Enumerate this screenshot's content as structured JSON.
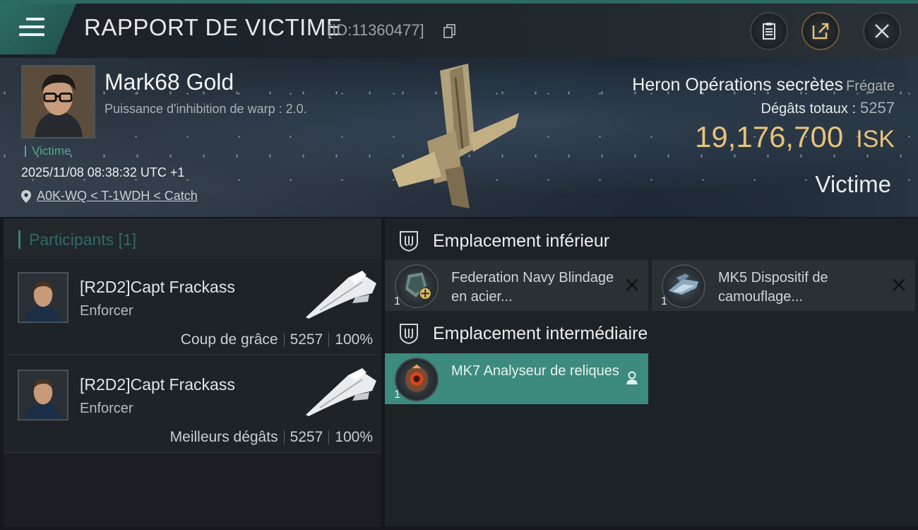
{
  "header": {
    "title": "RAPPORT DE VICTIME",
    "id_label": "[ID:11360477]",
    "buttons": [
      "clipboard-icon",
      "share-icon",
      "close-icon"
    ]
  },
  "victim": {
    "name": "Mark68 Gold",
    "subtitle": "Puissance d'inhibition de warp : 2.0.",
    "role_tag": "Victime",
    "datetime": "2025/11/08 08:38:32 UTC +1",
    "location": "A0K-WQ < T-1WDH < Catch",
    "ship_name": "Heron Opérations secrètes",
    "ship_class": "Frégate",
    "total_damage_label": "Dégâts totaux :",
    "total_damage_value": "5257",
    "isk_value": "19,176,700",
    "isk_unit": "ISK",
    "role_right": "Victime"
  },
  "participants": {
    "label": "Participants",
    "count": "[1]",
    "rows": [
      {
        "name": "[R2D2]Capt Frackass",
        "ship": "Enforcer",
        "stat_label": "Coup de grâce",
        "damage": "5257",
        "percent": "100%"
      },
      {
        "name": "[R2D2]Capt Frackass",
        "ship": "Enforcer",
        "stat_label": "Meilleurs dégâts",
        "damage": "5257",
        "percent": "100%"
      }
    ]
  },
  "slots": {
    "low": {
      "label": "Emplacement inférieur",
      "modules": [
        {
          "name": "Federation Navy Blindage en acier...",
          "qty": "1"
        },
        {
          "name": "MK5 Dispositif de camouflage...",
          "qty": "1"
        }
      ]
    },
    "mid": {
      "label": "Emplacement intermédiaire",
      "modules": [
        {
          "name": "MK7 Analyseur de reliques",
          "qty": "1"
        }
      ]
    }
  },
  "colors": {
    "accent": "#3c8b7e",
    "isk": "#e8c37a",
    "victim_tag": "#52a88f"
  }
}
